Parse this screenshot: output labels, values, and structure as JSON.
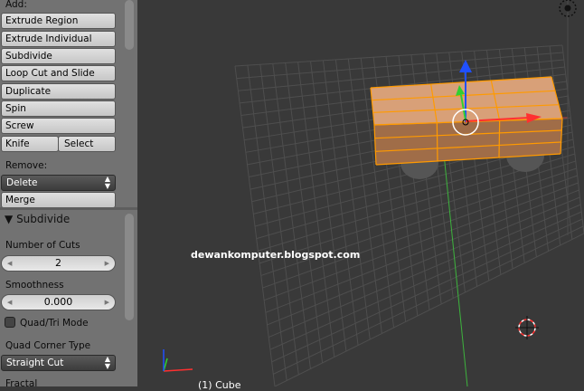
{
  "toolshelf": {
    "add_label": "Add:",
    "add_buttons": [
      "Extrude Region",
      "Extrude Individual",
      "Subdivide",
      "Loop Cut and Slide",
      "Duplicate",
      "Spin",
      "Screw"
    ],
    "knife_label": "Knife",
    "select_label": "Select",
    "remove_label": "Remove:",
    "delete_value": "Delete",
    "merge_label": "Merge"
  },
  "operator_panel": {
    "title": "Subdivide",
    "number_of_cuts_label": "Number of Cuts",
    "number_of_cuts_value": "2",
    "smoothness_label": "Smoothness",
    "smoothness_value": "0.000",
    "quad_tri_label": "Quad/Tri Mode",
    "quad_tri_checked": false,
    "quad_corner_label": "Quad Corner Type",
    "quad_corner_value": "Straight Cut",
    "fractal_label": "Fractal"
  },
  "viewport": {
    "object_label": "(1) Cube",
    "watermark": "dewankomputer.blogspot.com",
    "colors": {
      "background": "#393939",
      "grid": "#4e4e4e",
      "mesh_face": "#d8a078",
      "mesh_edge": "#ff9a00",
      "wheel": "#555555",
      "axis_x": "#ff3030",
      "axis_y": "#30d030",
      "axis_z": "#2050ff"
    }
  }
}
